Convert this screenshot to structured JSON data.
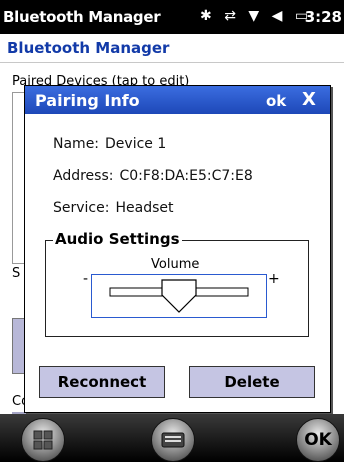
{
  "status_bar": {
    "title": "Bluetooth Manager",
    "time": "3:28",
    "icons": [
      "bluetooth-icon",
      "sync-icon",
      "signal-icon",
      "volume-icon",
      "battery-icon"
    ]
  },
  "app": {
    "title": "Bluetooth Manager"
  },
  "background": {
    "label1": "Paired Devices (tap to edit)",
    "label2": "S",
    "label3": "Co"
  },
  "dialog": {
    "title": "Pairing Info",
    "ok": "ok",
    "close": "X",
    "name_label": "Name:",
    "name_value": "Device 1",
    "address_label": "Address:",
    "address_value": "C0:F8:DA:E5:C7:E8",
    "service_label": "Service:",
    "service_value": "Headset",
    "audio_group": "Audio Settings",
    "volume_label": "Volume",
    "volume_minus": "-",
    "volume_plus": "+",
    "reconnect": "Reconnect",
    "delete": "Delete"
  },
  "softkeys": {
    "ok": "OK"
  },
  "colors": {
    "accent": "#2a5ad0",
    "button": "#c5c5e3",
    "title_text": "#123aa8"
  }
}
